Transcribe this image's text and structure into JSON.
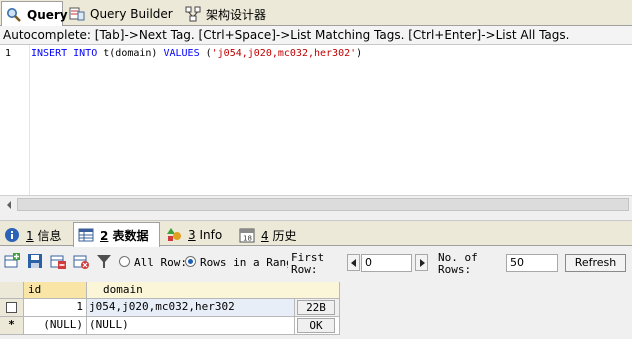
{
  "top_tabs": [
    {
      "label": "Query"
    },
    {
      "label": "Query Builder"
    },
    {
      "label": "架构设计器"
    }
  ],
  "autocomplete_hint": "Autocomplete: [Tab]->Next Tag. [Ctrl+Space]->List Matching Tags. [Ctrl+Enter]->List All Tags.",
  "editor": {
    "line_number": "1",
    "kw1": "INSERT INTO",
    "plain1": " t(domain) ",
    "kw2": "VALUES",
    "plain2": " (",
    "str": "'j054,j020,mc032,her302'",
    "plain3": ")"
  },
  "bottom_tabs": [
    {
      "num": "1",
      "label": " 信息"
    },
    {
      "num": "2",
      "label": " 表数据"
    },
    {
      "num": "3",
      "label": " Info"
    },
    {
      "num": "4",
      "label": " 历史"
    }
  ],
  "toolbar": {
    "all_row_label": "All Row:",
    "range_label": "Rows in a Rang",
    "first_row_label_1": "First",
    "first_row_label_2": "Row:",
    "first_row_value": "0",
    "rows_label_1": "No. of",
    "rows_label_2": "Rows:",
    "rows_value": "50",
    "refresh_label": "Refresh"
  },
  "grid": {
    "columns": [
      "id",
      "domain"
    ],
    "rows": [
      {
        "marker": "",
        "id": "1",
        "domain": "j054,j020,mc032,her302",
        "size": "22B"
      },
      {
        "marker": "*",
        "id": "(NULL)",
        "domain": "(NULL)",
        "size": "OK"
      }
    ]
  },
  "colors": {
    "accent": "#1a5fb4",
    "keyword": "#0000ff",
    "string": "#c00000",
    "header_bg": "#fbf6d8"
  }
}
